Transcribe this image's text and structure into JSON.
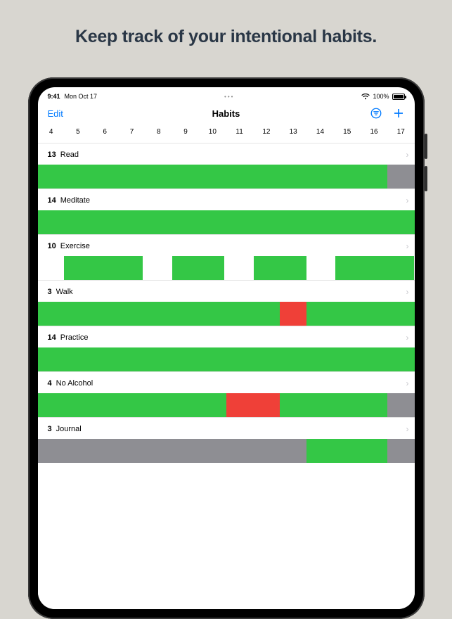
{
  "promo": {
    "headline": "Keep track of your intentional habits."
  },
  "status": {
    "time": "9:41",
    "date": "Mon Oct 17",
    "center_glyph": "•••",
    "battery_pct": "100%"
  },
  "nav": {
    "edit_label": "Edit",
    "title": "Habits"
  },
  "days": [
    "4",
    "5",
    "6",
    "7",
    "8",
    "9",
    "10",
    "11",
    "12",
    "13",
    "14",
    "15",
    "16",
    "17"
  ],
  "habits": [
    {
      "count": "13",
      "name": "Read",
      "segments": [
        {
          "state": "done",
          "span": 13
        },
        {
          "state": "na",
          "span": 1
        }
      ]
    },
    {
      "count": "14",
      "name": "Meditate",
      "segments": [
        {
          "state": "done",
          "span": 14
        }
      ]
    },
    {
      "count": "10",
      "name": "Exercise",
      "segments": [
        {
          "state": "empty",
          "span": 1
        },
        {
          "state": "done",
          "span": 3,
          "gap_after": true
        },
        {
          "state": "empty",
          "span": 1
        },
        {
          "state": "done",
          "span": 2,
          "gap_after": true
        },
        {
          "state": "empty",
          "span": 1
        },
        {
          "state": "done",
          "span": 2,
          "gap_after": true
        },
        {
          "state": "empty",
          "span": 1
        },
        {
          "state": "done",
          "span": 3
        }
      ]
    },
    {
      "count": "3",
      "name": "Walk",
      "segments": [
        {
          "state": "done",
          "span": 9
        },
        {
          "state": "miss",
          "span": 1
        },
        {
          "state": "done",
          "span": 4
        }
      ]
    },
    {
      "count": "14",
      "name": "Practice",
      "segments": [
        {
          "state": "done",
          "span": 14
        }
      ]
    },
    {
      "count": "4",
      "name": "No Alcohol",
      "segments": [
        {
          "state": "done",
          "span": 7
        },
        {
          "state": "miss",
          "span": 2
        },
        {
          "state": "done",
          "span": 4
        },
        {
          "state": "na",
          "span": 1
        }
      ]
    },
    {
      "count": "3",
      "name": "Journal",
      "segments": [
        {
          "state": "na",
          "span": 10
        },
        {
          "state": "done",
          "span": 3
        },
        {
          "state": "na",
          "span": 1
        }
      ]
    }
  ]
}
